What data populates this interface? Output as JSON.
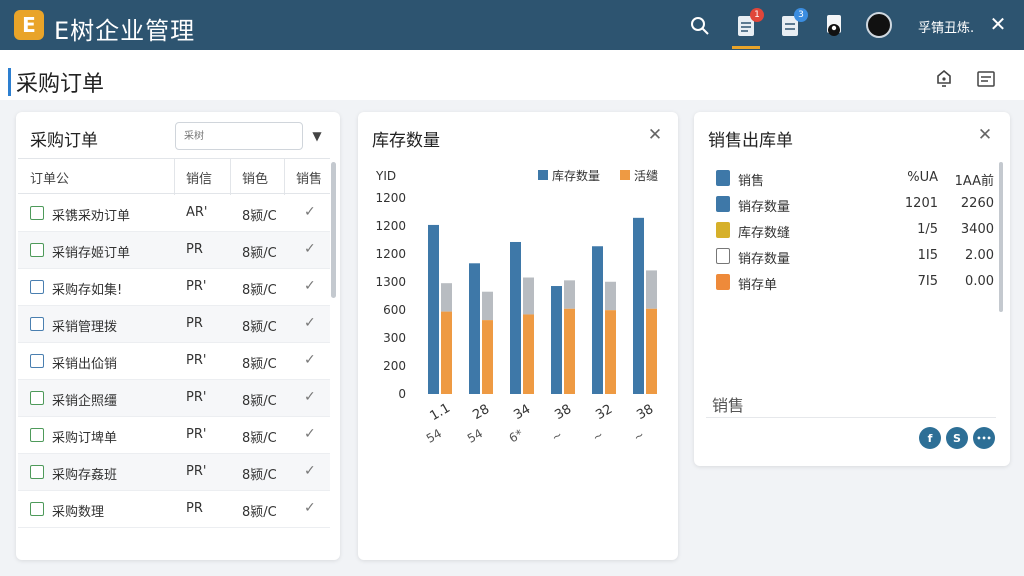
{
  "app": {
    "logo_letter": "E",
    "title": "E树企业管理",
    "username": "孚锖丑炼."
  },
  "topbar": {
    "badge_1": "1",
    "badge_2": "3"
  },
  "page": {
    "title": "采购订单"
  },
  "left_panel": {
    "title": "采购订单",
    "search_placeholder": "采树",
    "columns": [
      "订单公",
      "销信",
      "销色",
      "销售"
    ],
    "rows": [
      {
        "name": "采镌采劝订单",
        "c2": "AR'",
        "c3": "8颍/C",
        "style": "green"
      },
      {
        "name": "采销存姬订单",
        "c2": "PR",
        "c3": "8颍/C",
        "style": "green"
      },
      {
        "name": "采购存如集!",
        "c2": "PR'",
        "c3": "8颍/C",
        "style": "blue"
      },
      {
        "name": "采销管理拨",
        "c2": "PR",
        "c3": "8颍/C",
        "style": "blue"
      },
      {
        "name": "采销出佡销",
        "c2": "PR'",
        "c3": "8颍/C",
        "style": "blue"
      },
      {
        "name": "采销企照缰",
        "c2": "PR'",
        "c3": "8颍/C",
        "style": "green"
      },
      {
        "name": "采购订埤单",
        "c2": "PR'",
        "c3": "8颍/C",
        "style": "green"
      },
      {
        "name": "采购存姦班",
        "c2": "PR'",
        "c3": "8颍/C",
        "style": "green"
      },
      {
        "name": "采购数理",
        "c2": "PR",
        "c3": "8颍/C",
        "style": "green"
      }
    ]
  },
  "chart_panel": {
    "title": "库存数量",
    "chart_data": {
      "type": "bar",
      "ylabel": "YID",
      "legend": [
        "库存数量",
        "活缱"
      ],
      "legend_position": "top-right",
      "y_ticks": [
        "1200",
        "1200",
        "1200",
        "1300",
        "600",
        "300",
        "200",
        "0"
      ],
      "x_ticks_top": [
        "1.1",
        "28",
        "34",
        "38",
        "32",
        "38"
      ],
      "x_ticks_bottom": [
        "54",
        "54",
        "6*",
        "~",
        "~",
        "~"
      ],
      "series": [
        {
          "name": "库存数量",
          "color": "#3e78a8",
          "values": [
            1190,
            920,
            1070,
            760,
            1040,
            1240
          ]
        },
        {
          "name": "活缱",
          "color": "#ee9a43",
          "values": [
            580,
            520,
            560,
            600,
            590,
            600
          ]
        }
      ],
      "gray_caps": [
        200,
        200,
        260,
        200,
        200,
        270
      ],
      "ylim": [
        0,
        1450
      ],
      "grid": false
    }
  },
  "right_panel": {
    "title": "销售出库单",
    "header": {
      "label": "销售",
      "v1": "%UA",
      "v2": "1AA前"
    },
    "items": [
      {
        "label": "销存数量",
        "v1": "1201",
        "v2": "2260",
        "icon_color": "#3e78a8"
      },
      {
        "label": "库存数缝",
        "v1": "1/5",
        "v2": "3400",
        "icon_color": "#d6b02a"
      },
      {
        "label": "销存数量",
        "v1": "1I5",
        "v2": "2.00",
        "icon_color": "#ffffff"
      },
      {
        "label": "销存单",
        "v1": "7I5",
        "v2": "0.00",
        "icon_color": "#ee8a3a"
      }
    ],
    "footer_label": "销售",
    "share": [
      "f",
      "S",
      "•••"
    ]
  }
}
